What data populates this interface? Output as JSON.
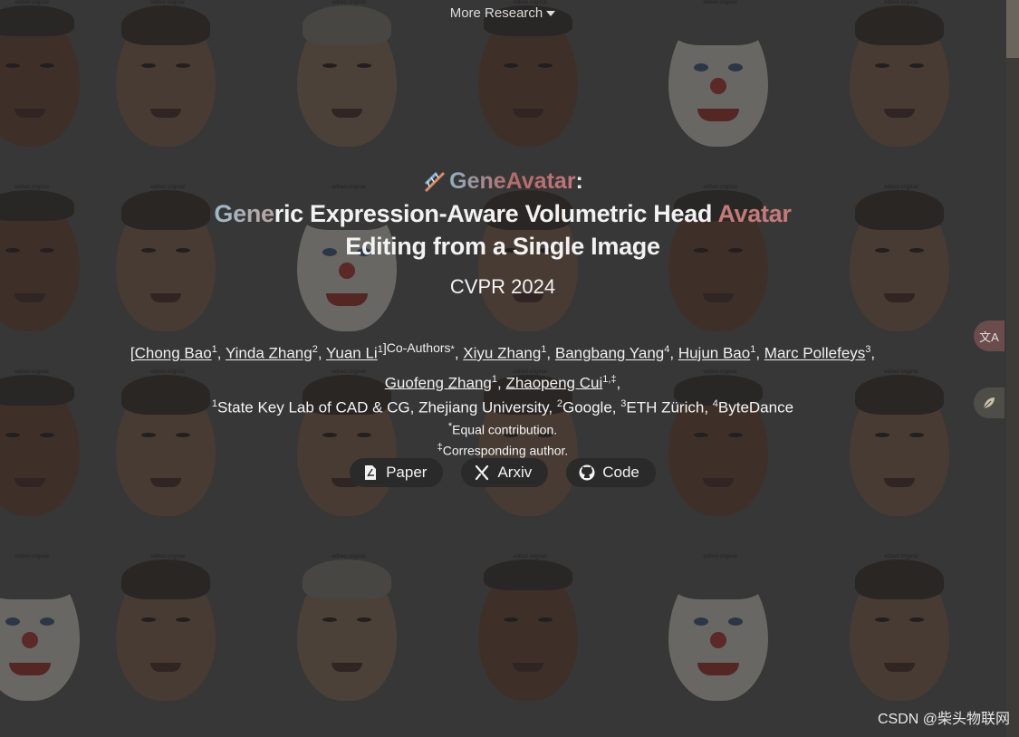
{
  "nav": {
    "more_research": "More Research"
  },
  "hero": {
    "project_name": "GeneAvatar",
    "colon": ":",
    "title_line1_grad": "Gene",
    "title_line1_rest": "ric Expression-Aware Volumetric Head ",
    "title_line1_accent": "Avatar",
    "title_line2": "Editing from a Single Image",
    "venue": "CVPR 2024"
  },
  "authors": {
    "open_bracket": "[",
    "a1": "Chong Bao",
    "a1_sup": "1",
    "a2": "Yinda Zhang",
    "a2_sup": "2",
    "a3": "Yuan Li",
    "a3_sup": "1",
    "co_authors": "]Co-Authors",
    "co_sup": "*",
    "a4": "Xiyu Zhang",
    "a4_sup": "1",
    "a5": "Bangbang Yang",
    "a5_sup": "4",
    "a6": "Hujun Bao",
    "a6_sup": "1",
    "a7": "Marc Pollefeys",
    "a7_sup": "3",
    "a8": "Guofeng Zhang",
    "a8_sup": "1",
    "a9": "Zhaopeng Cui",
    "a9_sup": "1,‡"
  },
  "affiliations": {
    "s1": "1",
    "aff1": "State Key Lab of CAD & CG, Zhejiang University, ",
    "s2": "2",
    "aff2": "Google, ",
    "s3": "3",
    "aff3": "ETH Zürich, ",
    "s4": "4",
    "aff4": "ByteDance",
    "equal_sup": "*",
    "equal": "Equal contribution.",
    "corr_sup": "‡",
    "corr": "Corresponding author."
  },
  "buttons": {
    "paper": "Paper",
    "arxiv": "Arxiv",
    "code": "Code"
  },
  "side": {
    "translate_glyph": "文A"
  },
  "mosaic": {
    "caption": "edited   original"
  },
  "watermark": "CSDN @柴头物联网",
  "colors": {
    "background": "#4a4a49",
    "button_bg": "#2a2a2a",
    "accent_avatar": "#c27a7b"
  }
}
